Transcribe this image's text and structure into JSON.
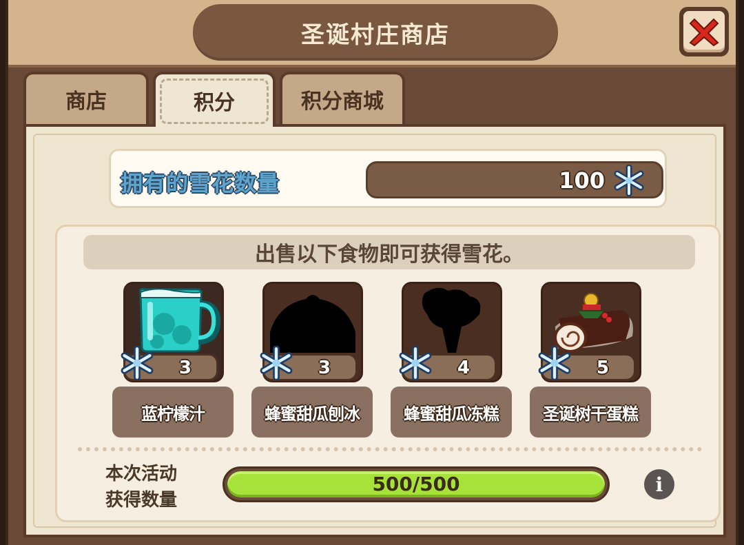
{
  "header": {
    "title": "圣诞村庄商店"
  },
  "tabs": [
    {
      "label": "商店",
      "active": false
    },
    {
      "label": "积分",
      "active": true
    },
    {
      "label": "积分商城",
      "active": false
    }
  ],
  "owned": {
    "label": "拥有的雪花数量",
    "value": "100",
    "icon": "snowflake-icon"
  },
  "sell": {
    "banner": "出售以下食物即可获得雪花。",
    "items": [
      {
        "name": "蓝柠檬汁",
        "points": "3",
        "icon": "blue-lemonade-jug-icon"
      },
      {
        "name": "蜂蜜甜瓜刨冰",
        "points": "3",
        "icon": "locked-silhouette-icon"
      },
      {
        "name": "蜂蜜甜瓜冻糕",
        "points": "4",
        "icon": "locked-silhouette-icon"
      },
      {
        "name": "圣诞树干蛋糕",
        "points": "5",
        "icon": "yule-log-cake-icon"
      }
    ]
  },
  "progress": {
    "label_line1": "本次活动",
    "label_line2": "获得数量",
    "text": "500/500",
    "fraction": 1.0
  },
  "colors": {
    "title_pill": "#7a5840",
    "progress_fill": "#a6e23a",
    "owned_label": "#5fa4cc",
    "close_x": "#d8281c"
  }
}
